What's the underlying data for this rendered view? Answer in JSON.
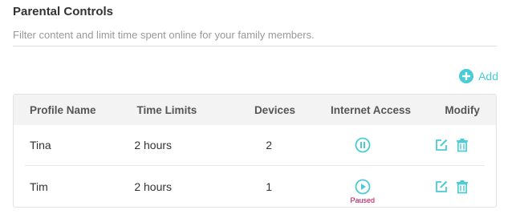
{
  "header": {
    "title": "Parental Controls",
    "subtitle": "Filter content and limit time spent online for your family members."
  },
  "toolbar": {
    "add_label": "Add"
  },
  "table": {
    "columns": [
      "Profile Name",
      "Time Limits",
      "Devices",
      "Internet Access",
      "Modify"
    ],
    "rows": [
      {
        "name": "Tina",
        "time_limit": "2 hours",
        "devices": "2",
        "internet_status": "active",
        "status_label": ""
      },
      {
        "name": "Tim",
        "time_limit": "2 hours",
        "devices": "1",
        "internet_status": "paused",
        "status_label": "Paused"
      }
    ]
  },
  "colors": {
    "accent": "#4acbd6",
    "paused": "#c0004a"
  }
}
